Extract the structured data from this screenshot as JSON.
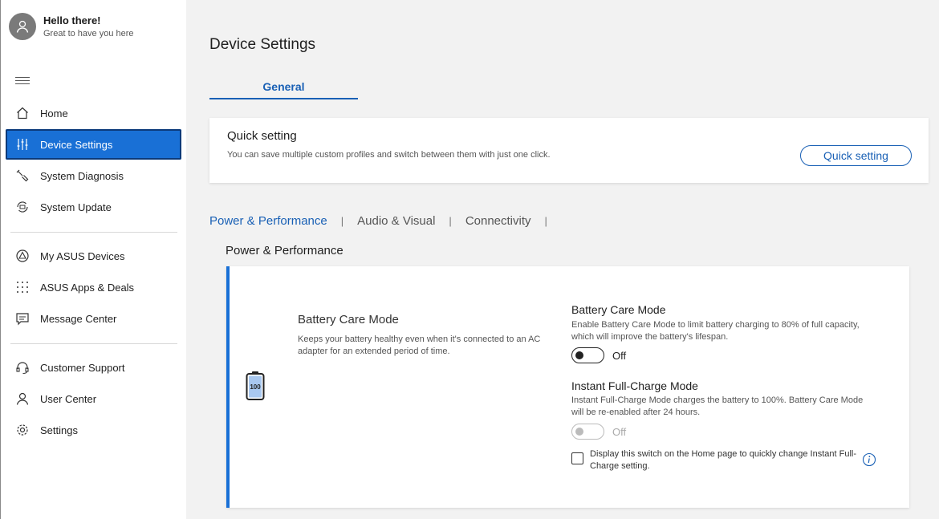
{
  "profile": {
    "greeting": "Hello there!",
    "subtitle": "Great to have you here"
  },
  "sidebar": {
    "items": [
      {
        "label": "Home",
        "icon": "home-icon"
      },
      {
        "label": "Device Settings",
        "icon": "sliders-icon",
        "active": true
      },
      {
        "label": "System Diagnosis",
        "icon": "wrench-icon"
      },
      {
        "label": "System Update",
        "icon": "update-icon"
      },
      {
        "label": "My ASUS Devices",
        "icon": "devices-icon"
      },
      {
        "label": "ASUS Apps & Deals",
        "icon": "apps-grid-icon"
      },
      {
        "label": "Message Center",
        "icon": "message-icon"
      },
      {
        "label": "Customer Support",
        "icon": "headset-icon"
      },
      {
        "label": "User Center",
        "icon": "user-icon"
      },
      {
        "label": "Settings",
        "icon": "gear-icon"
      }
    ]
  },
  "main": {
    "title": "Device Settings",
    "tab": "General",
    "quick_setting": {
      "title": "Quick setting",
      "description": "You can save multiple custom profiles and switch between them with just one click.",
      "button_label": "Quick setting"
    },
    "subtabs": [
      "Power & Performance",
      "Audio & Visual",
      "Connectivity"
    ],
    "section_title": "Power & Performance",
    "battery_card": {
      "battery_level": "100",
      "title": "Battery Care Mode",
      "description": "Keeps your battery healthy even when it's connected to an AC adapter for an extended period of time.",
      "battery_care": {
        "title": "Battery Care Mode",
        "description": "Enable Battery Care Mode to limit battery charging to 80% of full capacity, which will improve the battery's lifespan.",
        "toggle_state": "Off"
      },
      "instant_charge": {
        "title": "Instant Full-Charge Mode",
        "description": "Instant Full-Charge Mode charges the battery to 100%. Battery Care Mode will be re-enabled after 24 hours.",
        "toggle_state": "Off"
      },
      "checkbox_label": "Display this switch on the Home page to quickly change Instant Full-Charge setting."
    }
  },
  "colors": {
    "accent": "#1960b5",
    "active_nav": "#1970d6"
  }
}
